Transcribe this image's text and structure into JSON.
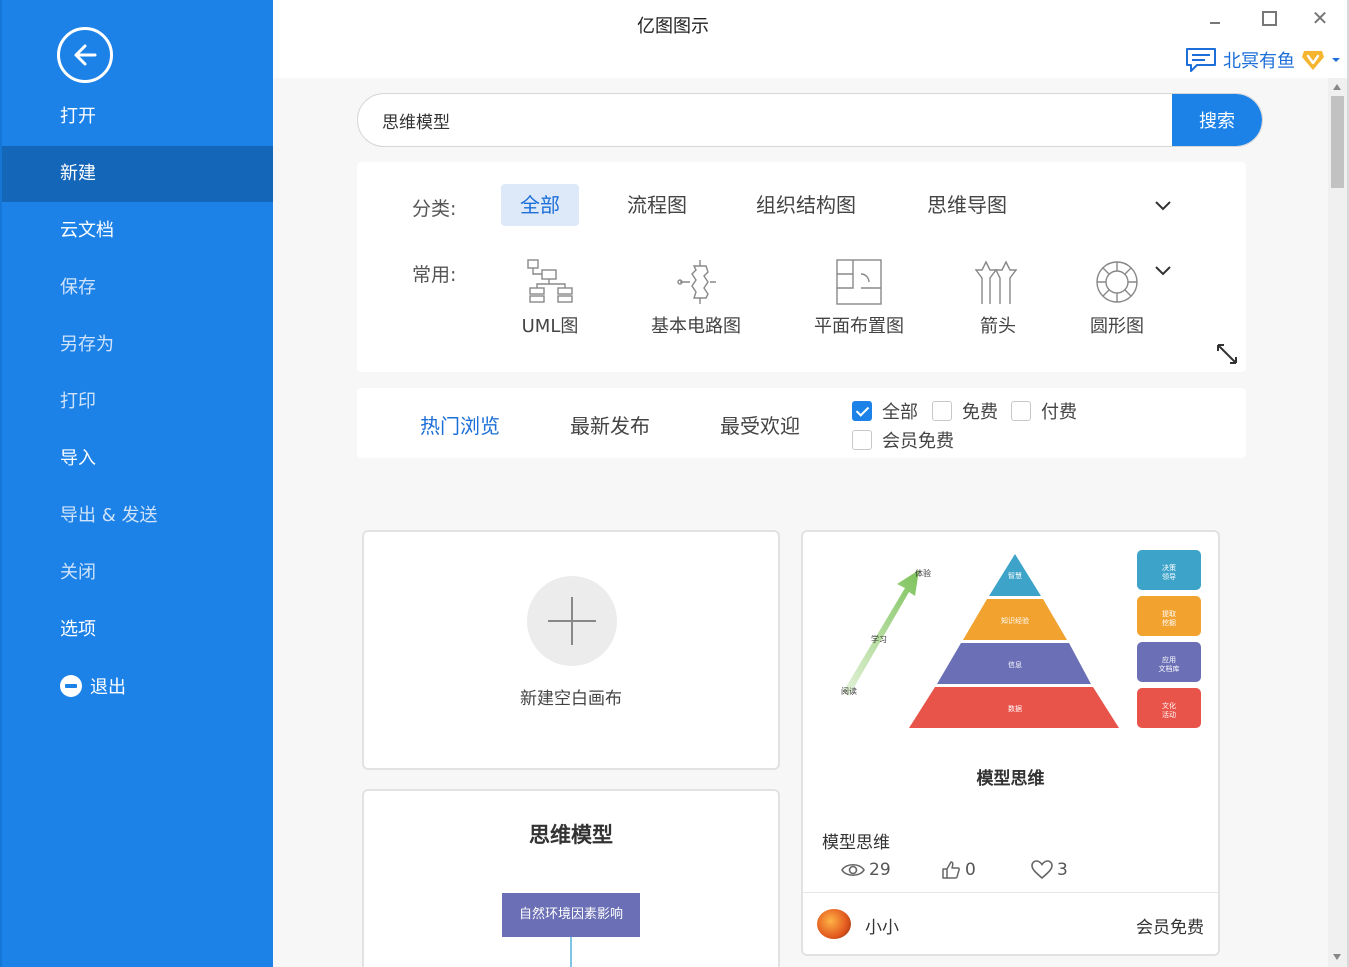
{
  "app": {
    "title": "亿图图示"
  },
  "user": {
    "name": "北冥有鱼"
  },
  "sidebar": {
    "items": [
      {
        "label": "打开"
      },
      {
        "label": "新建"
      },
      {
        "label": "云文档"
      },
      {
        "label": "保存"
      },
      {
        "label": "另存为"
      },
      {
        "label": "打印"
      },
      {
        "label": "导入"
      },
      {
        "label": "导出 & 发送"
      },
      {
        "label": "关闭"
      },
      {
        "label": "选项"
      },
      {
        "label": "退出"
      }
    ]
  },
  "search": {
    "value": "思维模型",
    "button": "搜索"
  },
  "categories": {
    "label": "分类:",
    "tabs": [
      {
        "label": "全部"
      },
      {
        "label": "流程图"
      },
      {
        "label": "组织结构图"
      },
      {
        "label": "思维导图"
      }
    ]
  },
  "common": {
    "label": "常用:",
    "items": [
      {
        "label": "UML图"
      },
      {
        "label": "基本电路图"
      },
      {
        "label": "平面布置图"
      },
      {
        "label": "箭头"
      },
      {
        "label": "圆形图"
      }
    ]
  },
  "filter": {
    "sort_tabs": [
      {
        "label": "热门浏览"
      },
      {
        "label": "最新发布"
      },
      {
        "label": "最受欢迎"
      }
    ],
    "checkboxes": [
      {
        "label": "全部",
        "checked": true
      },
      {
        "label": "免费",
        "checked": false
      },
      {
        "label": "付费",
        "checked": false
      },
      {
        "label": "会员免费",
        "checked": false
      }
    ]
  },
  "new_canvas": {
    "label": "新建空白画布"
  },
  "template": {
    "caption": "模型思维",
    "name": "模型思维",
    "views": "29",
    "likes": "0",
    "favorites": "3",
    "author": "小小",
    "price": "会员免费",
    "thumb_arrow_labels": [
      "体验",
      "学习",
      "阅读"
    ],
    "thumb_pyramid_labels": [
      "智慧",
      "知识经验",
      "信息",
      "数据"
    ],
    "thumb_side_labels": [
      "决策\n领导",
      "提取\n挖掘",
      "应用\n文档库",
      "文化\n活动"
    ]
  },
  "template2": {
    "title": "思维模型",
    "node": "自然环境因素影响"
  },
  "colors": {
    "accent": "#1c82e8",
    "sidebar_active": "#1466b9",
    "pyramid": [
      "#3da3c9",
      "#f2a22f",
      "#6b6fb5",
      "#e8534a"
    ]
  }
}
